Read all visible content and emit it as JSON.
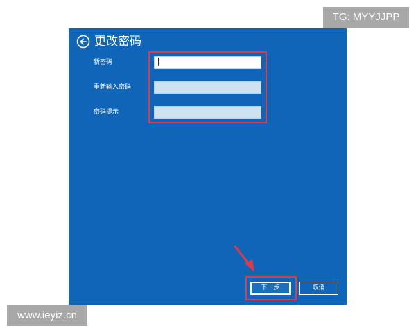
{
  "dialog": {
    "title": "更改密码",
    "fields": [
      {
        "label": "新密码",
        "value": ""
      },
      {
        "label": "重新输入密码",
        "value": ""
      },
      {
        "label": "密码提示",
        "value": ""
      }
    ],
    "buttons": {
      "next": "下一步",
      "cancel": "取消"
    }
  },
  "colors": {
    "panel": "#0f66b8",
    "highlight": "#e03a46"
  },
  "icons": {
    "back": "back-arrow-circle-icon",
    "pointer": "red-arrow-icon"
  },
  "watermarks": {
    "top": "TG: MYYJJPP",
    "bottom": "www.ieyiz.cn"
  }
}
